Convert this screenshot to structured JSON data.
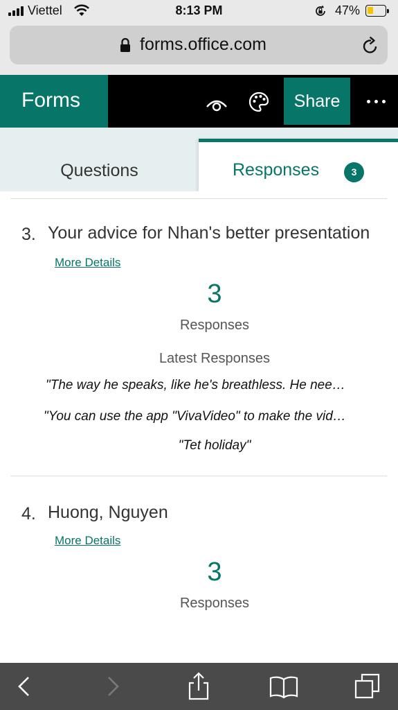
{
  "status_bar": {
    "carrier": "Viettel",
    "time": "8:13 PM",
    "battery_percent": "47%",
    "battery_level": 0.35,
    "icons": [
      "signal-icon",
      "wifi-icon",
      "rotation-lock-icon",
      "battery-icon"
    ]
  },
  "browser": {
    "url": "forms.office.com",
    "icons": [
      "lock-icon",
      "reload-icon"
    ]
  },
  "header": {
    "brand": "Forms",
    "share_label": "Share",
    "icons": [
      "preview-eye-icon",
      "theme-palette-icon",
      "more-options-icon"
    ]
  },
  "tabs": {
    "questions_label": "Questions",
    "responses_label": "Responses",
    "responses_count": "3",
    "active": "Responses"
  },
  "questions": [
    {
      "number": "3.",
      "title": "Your advice for Nhan's better presentation",
      "more_details": "More Details",
      "count": "3",
      "count_label": "Responses",
      "latest_label": "Latest Responses",
      "latest_responses": [
        "\"The way he speaks, like he's breathless. He nee…",
        "\"You can use the app \"VivaVideo\" to make the vid…",
        "\"Tet holiday\""
      ]
    },
    {
      "number": "4.",
      "title": "Huong, Nguyen",
      "more_details": "More Details",
      "count": "3",
      "count_label": "Responses"
    }
  ],
  "colors": {
    "brand_teal": "#077568",
    "header_black": "#000000",
    "toolbar_gray": "#4a4a4a"
  },
  "toolbar_icons": [
    "back-icon",
    "forward-icon",
    "share-icon",
    "bookmarks-icon",
    "tabs-icon"
  ]
}
